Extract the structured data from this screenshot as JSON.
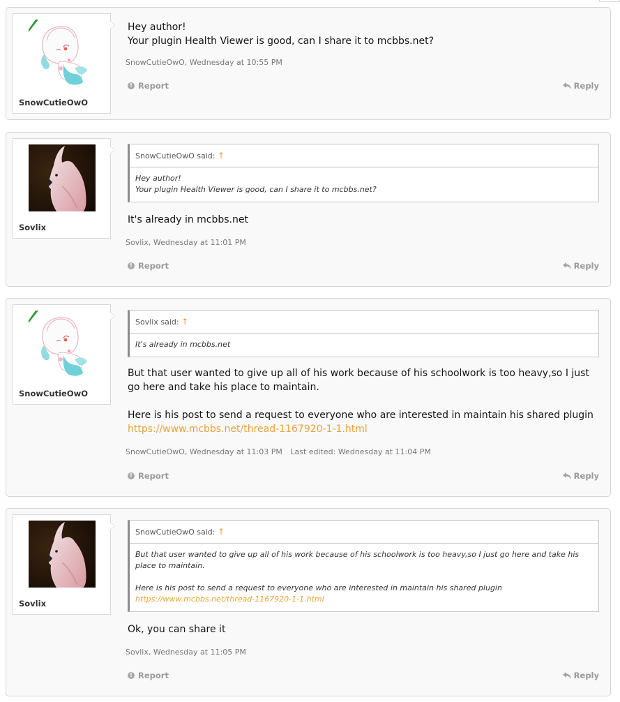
{
  "posts": [
    {
      "username": "SnowCutieOwO",
      "lines": [
        "Hey author!",
        "Your plugin Health Viewer is good, can I share it to mcbbs.net?"
      ],
      "meta": "SnowCutieOwO, Wednesday at 10:55 PM",
      "report": "Report",
      "reply": "Reply"
    },
    {
      "username": "Sovlix",
      "quote": {
        "head": "SnowCutieOwO said:",
        "lines": [
          "Hey author!",
          "Your plugin Health Viewer is good, can I share it to mcbbs.net?"
        ]
      },
      "lines": [
        "It's already in mcbbs.net"
      ],
      "meta": "Sovlix, Wednesday at 11:01 PM",
      "report": "Report",
      "reply": "Reply"
    },
    {
      "username": "SnowCutieOwO",
      "quote": {
        "head": "Sovlix said:",
        "lines": [
          "It's already in mcbbs.net"
        ]
      },
      "para1": "But that user wanted to give up all of his work because of his schoolwork is too heavy,so I just go here and take his place to maintain.",
      "para2": "Here is his post to send a request to everyone who are interested in maintain his shared plugin",
      "link": "https://www.mcbbs.net/thread-1167920-1-1.html",
      "meta": "SnowCutieOwO, Wednesday at 11:03 PM",
      "edited": "Last edited: Wednesday at 11:04 PM",
      "report": "Report",
      "reply": "Reply"
    },
    {
      "username": "Sovlix",
      "quote": {
        "head": "SnowCutieOwO said:",
        "para1": "But that user wanted to give up all of his work because of his schoolwork is too heavy,so I just go here and take his place to maintain.",
        "para2": "Here is his post to send a request to everyone who are interested in maintain his shared plugin",
        "link": "https://www.mcbbs.net/thread-1167920-1-1.html"
      },
      "lines": [
        "Ok, you can share it"
      ],
      "meta": "Sovlix, Wednesday at 11:05 PM",
      "report": "Report",
      "reply": "Reply"
    }
  ],
  "icons": {
    "report": "report-icon",
    "reply": "reply-arrow-icon",
    "quote_jump": "up-arrow-icon"
  },
  "colors": {
    "link": "#e8a33a",
    "meta": "#777777",
    "action": "#9a9a9a"
  }
}
